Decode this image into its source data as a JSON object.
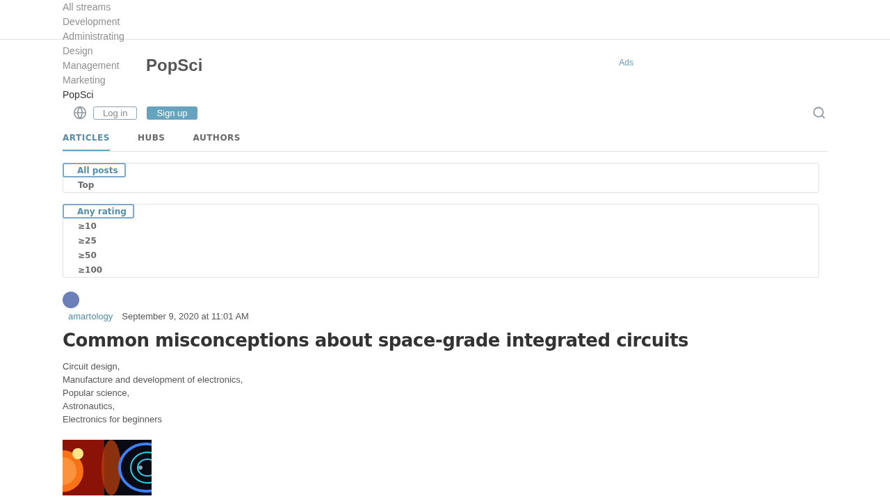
{
  "streams": [
    {
      "label": "All streams",
      "selected": false
    },
    {
      "label": "Development",
      "selected": false
    },
    {
      "label": "Administrating",
      "selected": false
    },
    {
      "label": "Design",
      "selected": false
    },
    {
      "label": "Management",
      "selected": false
    },
    {
      "label": "Marketing",
      "selected": false
    },
    {
      "label": "PopSci",
      "selected": true
    }
  ],
  "logo": "PopSci",
  "ads": "Ads",
  "auth": {
    "login": "Log in",
    "signup": "Sign up"
  },
  "tabs": [
    {
      "label": "ARTICLES",
      "selected": true
    },
    {
      "label": "HUBS",
      "selected": false
    },
    {
      "label": "AUTHORS",
      "selected": false
    }
  ],
  "filters": [
    {
      "options": [
        {
          "label": "All posts",
          "selected": true
        },
        {
          "label": "Top",
          "selected": false
        }
      ]
    },
    {
      "options": [
        {
          "label": "Any rating",
          "selected": true
        },
        {
          "label": "≥10",
          "selected": false
        },
        {
          "label": "≥25",
          "selected": false
        },
        {
          "label": "≥50",
          "selected": false
        },
        {
          "label": "≥100",
          "selected": false
        }
      ]
    }
  ],
  "post": {
    "author": "amartology",
    "date": "September 9, 2020 at 11:01 AM",
    "title": "Common misconceptions about space-grade integrated circuits",
    "hubs": [
      "Circuit design,",
      "Manufacture and development of electronics,",
      "Popular science,",
      "Astronautics,",
      "Electronics for beginners"
    ]
  }
}
